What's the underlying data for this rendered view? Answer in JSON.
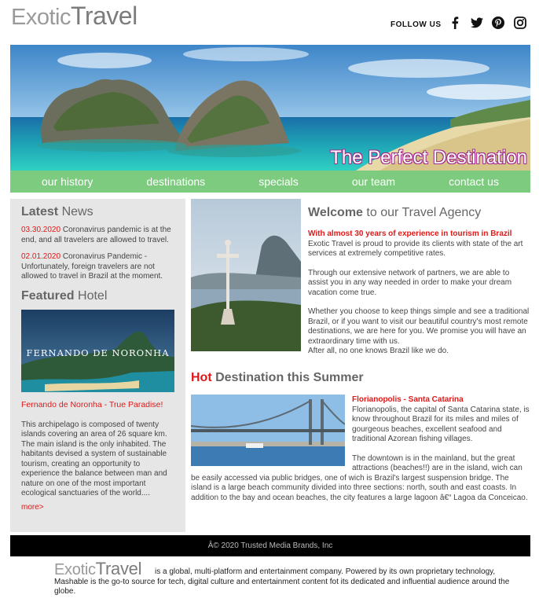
{
  "header": {
    "logo_part1": "Exotic",
    "logo_part2": "Travel",
    "follow_label": "FOLLOW US",
    "social": [
      "facebook-icon",
      "twitter-icon",
      "pinterest-icon",
      "instagram-icon"
    ]
  },
  "hero": {
    "caption": "The Perfect Destination"
  },
  "nav": {
    "items": [
      "our history",
      "destinations",
      "specials",
      "our team",
      "contact us"
    ]
  },
  "sidebar": {
    "news_title_bold": "Latest",
    "news_title_rest": " News",
    "news": [
      {
        "date": "03.30.2020",
        "text": " Coronavirus pandemic is at the end, and all travelers are allowed to travel."
      },
      {
        "date": "02.01.2020",
        "text": " Coronavirus Pandemic - Unfortunately, foreign travelers are not allowed to travel in Brazil at the moment."
      }
    ],
    "featured_title_bold": "Featured",
    "featured_title_rest": " Hotel",
    "hotel_image_caption": "FERNANDO DE NORONHA",
    "hotel_link": "Fernando de Noronha - True Paradise!",
    "hotel_description": "This archipelago is composed of twenty islands covering an area of 26 square km. The main island is the only inhabited. The habitants devised a system of sustainable tourism, creating an opportunity to experience the balance between man and nature on one of the most important ecological sanctuaries of the world....",
    "more_label": "more>"
  },
  "main": {
    "welcome_bold": "Welcome",
    "welcome_rest": " to our Travel Agency",
    "welcome_highlight": "With almost 30 years of experience in tourism in Brazil",
    "welcome_p1": "Exotic Travel is proud to provide its clients with state of the art services at extremely competitive rates.",
    "welcome_p2": "Through our extensive network of partners, we are able to assist you in any way needed in order to make your dream vacation come true.",
    "welcome_p3": "Whether you choose to keep things simple and see a traditional Brazil, or if you want to visit our beautiful country's most remote destinations, we are here for you. We promise you will have an extraordinary time with us.",
    "welcome_p4": "After all, no one knows Brazil like we do.",
    "hot_red": "Hot",
    "hot_mid": " Destination ",
    "hot_bold": "this Summer",
    "hot_place": "Florianopolis - Santa Catarina",
    "hot_p1": "Florianopolis, the capital of Santa Catarina state, is know throughout Brazil for its miles and miles of gourgeous beaches, excellent seafood and traditional Azorean fishing villages.",
    "hot_p2": "The downtown is in the mainland, but the great attractions (beaches!!) are in the island, wich can be easily accessed via public bridges, one of wich is Brazil's largest suspension bridge. The island is a large beach community divided into three sections: north, south and east coasts. In addition to the bay and ocean beaches, the city features a large lagoon â€“ Lagoa da Conceicao."
  },
  "footer": {
    "copyright": "Â© 2020 Trusted Media Brands, Inc",
    "logo_part1": "Exotic",
    "logo_part2": "Travel",
    "text": " is a global, multi-platform and entertainment company. Powered by its own proprietary technology, Mashable is the go-to source for tech, digital culture and entertainment content fot its dedicated and influential audience around the globe."
  }
}
